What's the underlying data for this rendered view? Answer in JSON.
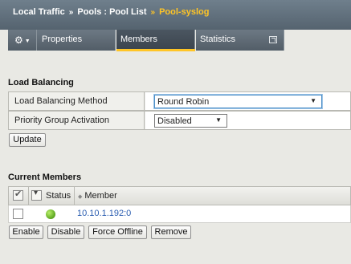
{
  "breadcrumb": {
    "part1": "Local Traffic",
    "sep1": "»",
    "part2": "Pools : Pool List",
    "sep2": "»",
    "current": "Pool-syslog"
  },
  "tabs": {
    "properties": "Properties",
    "members": "Members",
    "statistics": "Statistics"
  },
  "load_balancing": {
    "title": "Load Balancing",
    "method_label": "Load Balancing Method",
    "method_value": "Round Robin",
    "priority_label": "Priority Group Activation",
    "priority_value": "Disabled",
    "update_button": "Update"
  },
  "current_members": {
    "title": "Current Members",
    "columns": {
      "status": "Status",
      "member": "Member"
    },
    "rows": [
      {
        "member": "10.10.1.192:0",
        "status": "available"
      }
    ],
    "buttons": {
      "enable": "Enable",
      "disable": "Disable",
      "force_offline": "Force Offline",
      "remove": "Remove"
    }
  },
  "colors": {
    "accent": "#ffc526",
    "link": "#2a5db0",
    "status_available": "#5aa41e"
  }
}
